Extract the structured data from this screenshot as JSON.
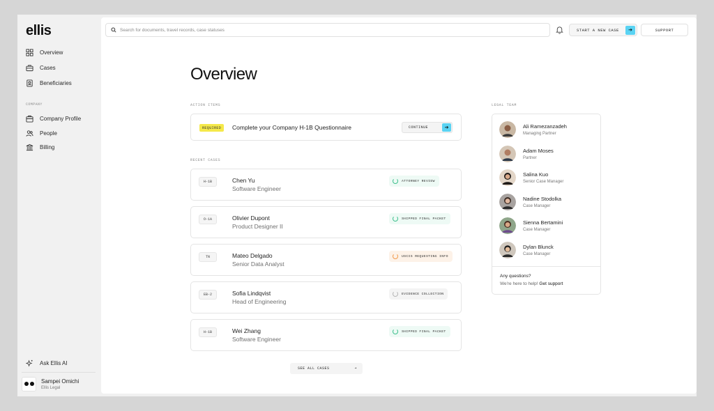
{
  "app": {
    "logo": "ellis"
  },
  "sidebar": {
    "items": [
      {
        "label": "Overview",
        "icon": "grid-icon"
      },
      {
        "label": "Cases",
        "icon": "briefcase-icon"
      },
      {
        "label": "Beneficiaries",
        "icon": "id-badge-icon"
      }
    ],
    "section_label": "COMPANY",
    "company_items": [
      {
        "label": "Company Profile",
        "icon": "building-icon"
      },
      {
        "label": "People",
        "icon": "people-icon"
      },
      {
        "label": "Billing",
        "icon": "bank-icon"
      }
    ],
    "ask_ai": {
      "label": "Ask Ellis AI",
      "icon": "sparkle-icon"
    },
    "user": {
      "name": "Sampei Omichi",
      "org": "Ellis Legal"
    }
  },
  "header": {
    "search_placeholder": "Search for documents, travel records, case statuses",
    "start_case_label": "START A NEW CASE",
    "support_label": "SUPPORT"
  },
  "main": {
    "title": "Overview",
    "action_items_label": "ACTION ITEMS",
    "action": {
      "badge": "REQUIRED",
      "text": "Complete your Company H-1B Questionnaire",
      "button": "CONTINUE"
    },
    "recent_cases_label": "RECENT CASES",
    "cases": [
      {
        "visa": "H-1B",
        "name": "Chen Yu",
        "role": "Software Engineer",
        "status": "ATTORNEY REVIEW",
        "status_color": "#3cbf8c",
        "status_bg": "#eefaf5"
      },
      {
        "visa": "O-1A",
        "name": "Olivier Dupont",
        "role": "Product Designer II",
        "status": "SHIPPED FINAL PACKET",
        "status_color": "#3cbf8c",
        "status_bg": "#eefaf5"
      },
      {
        "visa": "TN",
        "name": "Mateo Delgado",
        "role": "Senior Data Analyst",
        "status": "USCIS REQUESTING INFO",
        "status_color": "#f29a4a",
        "status_bg": "#fdf2e8"
      },
      {
        "visa": "EB-2",
        "name": "Sofia Lindqvist",
        "role": "Head of Engineering",
        "status": "EVIDENCE COLLECTION",
        "status_color": "#b5b5b5",
        "status_bg": "#f4f4f4"
      },
      {
        "visa": "H-1B",
        "name": "Wei Zhang",
        "role": "Software Engineer",
        "status": "SHIPPED FINAL PACKET",
        "status_color": "#3cbf8c",
        "status_bg": "#eefaf5"
      }
    ],
    "see_all_label": "SEE ALL CASES"
  },
  "legal_team": {
    "label": "LEGAL TEAM",
    "members": [
      {
        "name": "Ali Ramezanzadeh",
        "role": "Managing Partner"
      },
      {
        "name": "Adam Moses",
        "role": "Partner"
      },
      {
        "name": "Salina Kuo",
        "role": "Senior Case Manager"
      },
      {
        "name": "Nadine Stodolka",
        "role": "Case Manager"
      },
      {
        "name": "Sienna Bertamini",
        "role": "Case Manager"
      },
      {
        "name": "Dylan Blunck",
        "role": "Case Manager"
      }
    ],
    "question": "Any questions?",
    "help_text": "We're here to help!",
    "help_link": "Get support"
  }
}
